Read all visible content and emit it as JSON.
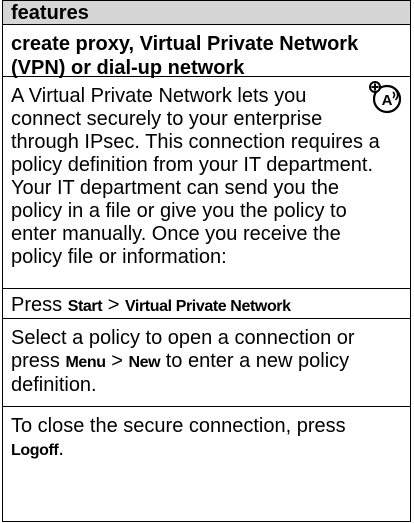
{
  "header": {
    "title": "features"
  },
  "section": {
    "title_line1": "create proxy, Virtual Private Network",
    "title_line2": "(VPN) or dial-up network"
  },
  "body": {
    "para1_lines": [
      "A Virtual Private Network lets you",
      "connect securely to your enterprise",
      "through IPsec. This connection requires a",
      "policy definition from your IT department.",
      "Your IT department can send you the",
      "policy in a file or give you the policy to",
      "enter manually. Once you receive the",
      "policy file or information:"
    ],
    "step_press": "Press ",
    "step_start": "Start",
    "step_sep": " > ",
    "step_vpn": "Virtual Private Network",
    "select_line1": "Select a policy to open a connection or",
    "select_press": "press ",
    "select_menu": "Menu",
    "select_sep": " > ",
    "select_new": "New",
    "select_line2_tail": " to enter a new policy",
    "select_line3": "definition.",
    "close_line1": "To close the secure connection, press",
    "close_logoff": "Logoff",
    "close_period": "."
  },
  "icon": {
    "name": "voice-command-icon",
    "glyph": "A"
  }
}
